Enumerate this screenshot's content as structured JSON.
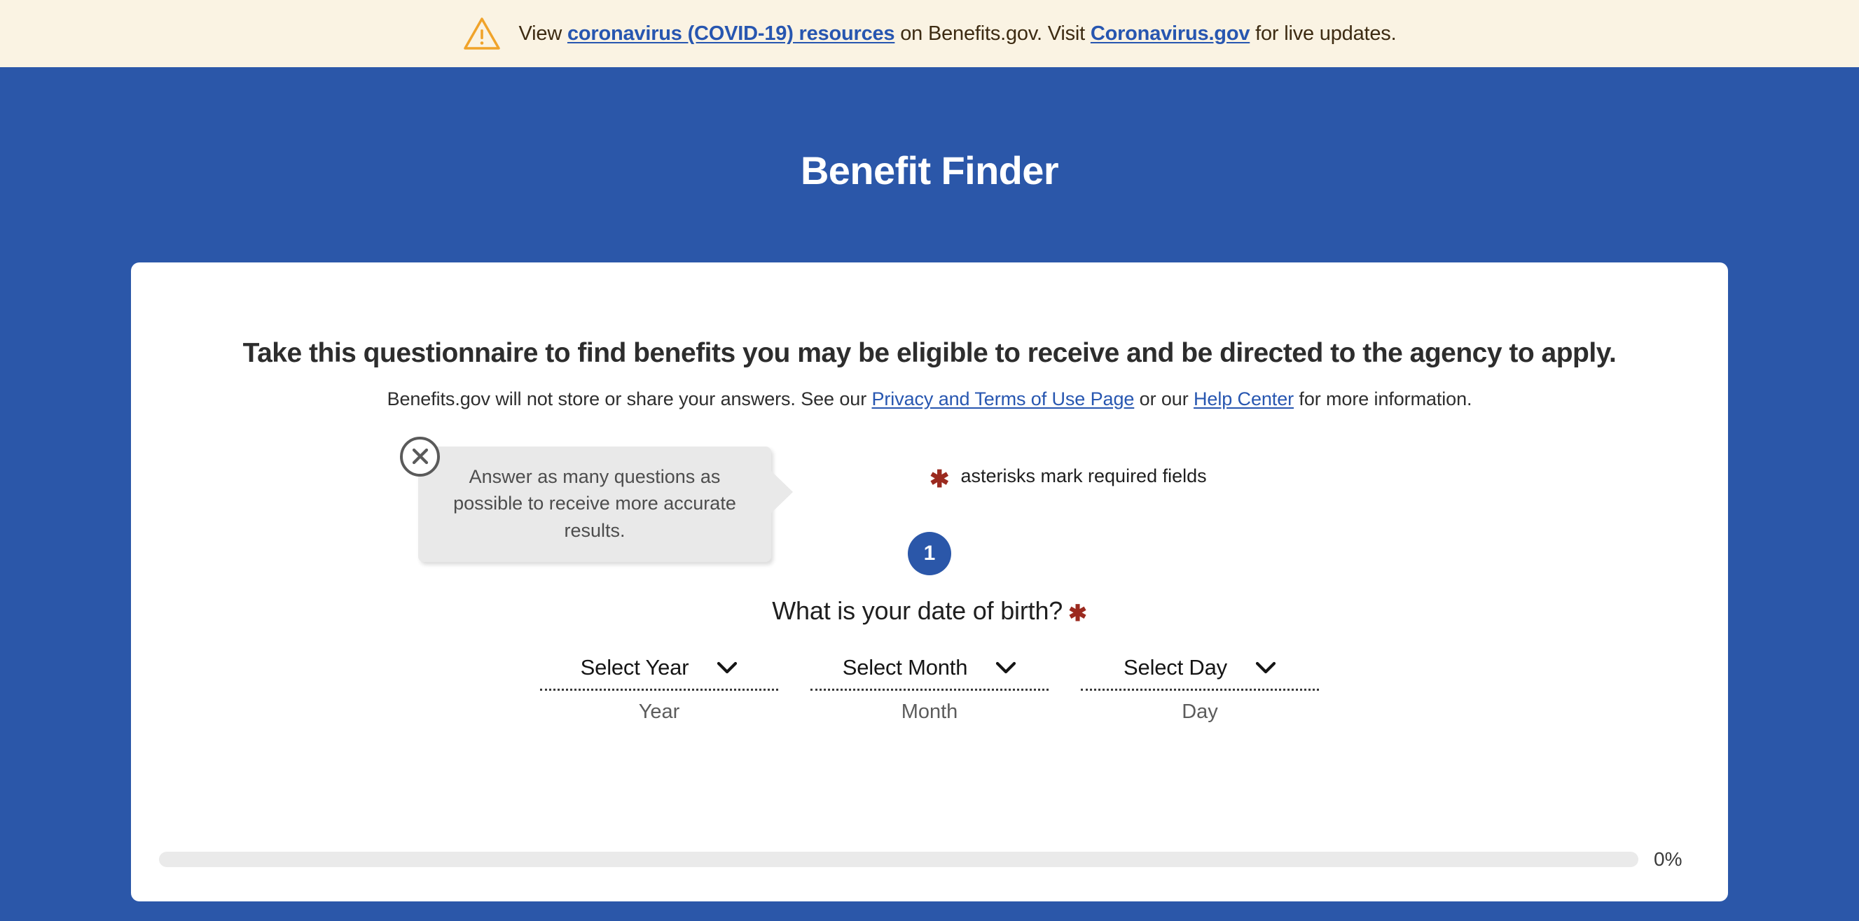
{
  "alert": {
    "icon": "warning-triangle-icon",
    "text_before": "View ",
    "link1": "coronavirus (COVID-19) resources",
    "text_middle": " on Benefits.gov. Visit ",
    "link2": "Coronavirus.gov",
    "text_after": " for live updates.",
    "background_color": "#faf3e3",
    "link_color": "#2756b0"
  },
  "header": {
    "title": "Benefit Finder",
    "background_color": "#2b57a9"
  },
  "card": {
    "heading": "Take this questionnaire to find benefits you may be eligible to receive and be directed to the agency to apply.",
    "sub_before": "Benefits.gov will not store or share your answers. See our ",
    "sub_link1": "Privacy and Terms of Use Page",
    "sub_middle": " or our ",
    "sub_link2": "Help Center",
    "sub_after": " for more information."
  },
  "tooltip": {
    "text": "Answer as many questions as possible to receive more accurate results.",
    "close_label": "close-tooltip",
    "background_color": "#e9e9e9"
  },
  "required_note": {
    "star": "✱",
    "text": "asterisks mark required fields",
    "star_color": "#9b2a1f"
  },
  "question": {
    "step_number": "1",
    "text": "What is your date of birth?",
    "star": "✱",
    "fields": [
      {
        "value": "Select Year",
        "label": "Year"
      },
      {
        "value": "Select Month",
        "label": "Month"
      },
      {
        "value": "Select Day",
        "label": "Day"
      }
    ]
  },
  "progress": {
    "percent_label": "0%",
    "percent_value": 0,
    "track_color": "#eaeaea",
    "fill_color": "#2b57a9"
  }
}
